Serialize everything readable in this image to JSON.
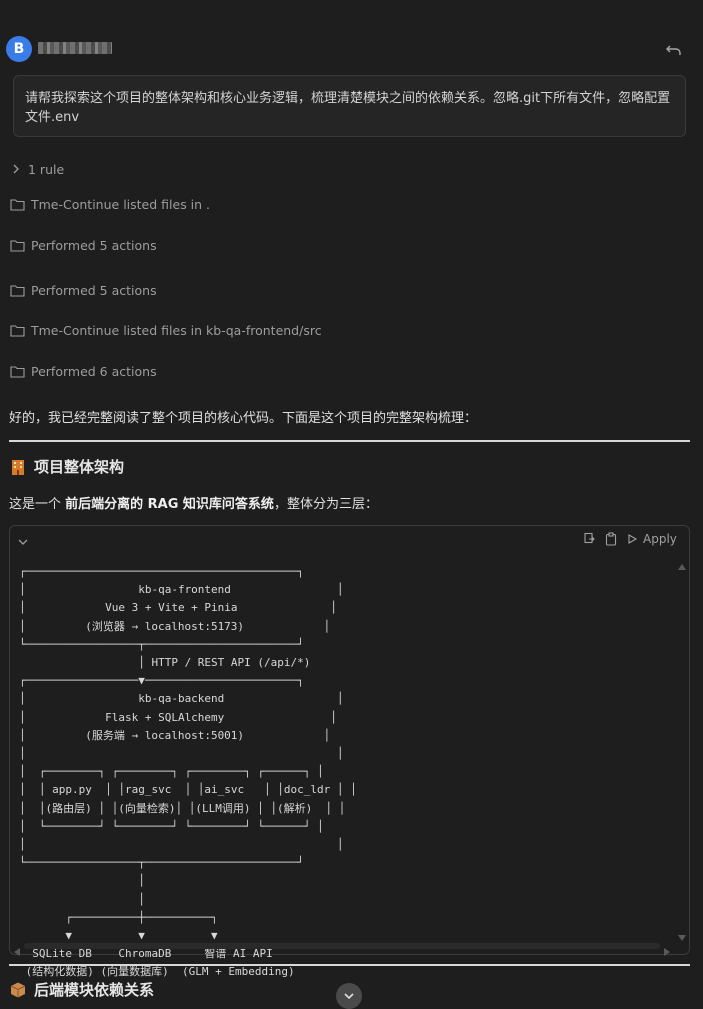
{
  "user": {
    "avatar_letter": "B"
  },
  "prompt": {
    "text": "请帮我探索这个项目的整体架构和核心业务逻辑，梳理清楚模块之间的依赖关系。忽略.git下所有文件，忽略配置文件.env"
  },
  "steps": {
    "rule_label": "1 rule",
    "items": [
      {
        "label": "Tme-Continue listed files in ."
      },
      {
        "label": "Performed 5 actions"
      },
      {
        "label": "Performed 5 actions"
      },
      {
        "label": "Tme-Continue listed files in kb-qa-frontend/src"
      },
      {
        "label": "Performed 6 actions"
      }
    ]
  },
  "response": {
    "intro": "好的，我已经完整阅读了整个项目的核心代码。下面是这个项目的完整架构梳理：",
    "section1_title": "项目整体架构",
    "desc_prefix": "这是一个 ",
    "desc_bold": "前后端分离的 RAG 知识库问答系统",
    "desc_suffix": "，整体分为三层：",
    "section2_title": "后端模块依赖关系"
  },
  "code_block": {
    "apply_label": "Apply",
    "content": "┌─────────────────────────────────────────┐\n│                 kb-qa-frontend                │\n│            Vue 3 + Vite + Pinia              │\n│         (浏览器 → localhost:5173)            │\n└─────────────────┬───────────────────────┘\n                  │ HTTP / REST API (/api/*)\n┌─────────────────▼───────────────────────┐\n│                 kb-qa-backend                 │\n│            Flask + SQLAlchemy                │\n│         (服务端 → localhost:5001)            │\n│                                               │\n│  ┌────────┐ ┌────────┐ ┌────────┐ ┌──────┐ │\n│  │ app.py  │ │rag_svc  │ │ai_svc   │ │doc_ldr │ │\n│  │(路由层) │ │(向量检索)│ │(LLM调用) │ │(解析)  │ │\n│  └────────┘ └────────┘ └────────┘ └──────┘ │\n│                                               │\n└─────────────────┬───────────────────────┘\n                  │\n                  │\n       ┌──────────┼──────────┐\n       ▼          ▼          ▼\n  SQLite DB    ChromaDB     智谱 AI API\n (结构化数据) (向量数据库)  (GLM + Embedding)"
  },
  "colors": {
    "background": "#1e1e1e",
    "avatar": "#3b7de8",
    "text": "#cccccc",
    "muted": "#9d9d9d"
  },
  "icons": {
    "undo": "undo-icon",
    "folder": "folder-icon",
    "chevron": "chevron-right-icon",
    "copy": "copy-icon",
    "clipboard": "clipboard-icon",
    "apply": "play-icon",
    "section1_emoji": "building-icon",
    "section2_emoji": "package-icon"
  }
}
